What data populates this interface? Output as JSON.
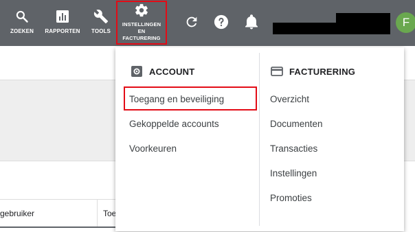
{
  "topbar": {
    "search_label": "ZOEKEN",
    "reports_label": "RAPPORTEN",
    "tools_label": "TOOLS",
    "settings_label_line1": "INSTELLINGEN",
    "settings_label_line2": "EN",
    "settings_label_line3": "FACTURERING",
    "avatar_letter": "F"
  },
  "background": {
    "column_user": "gebruiker",
    "column_next": "Toe"
  },
  "menu": {
    "account": {
      "header": "ACCOUNT",
      "items": [
        "Toegang en beveiliging",
        "Gekoppelde accounts",
        "Voorkeuren"
      ]
    },
    "billing": {
      "header": "FACTURERING",
      "items": [
        "Overzicht",
        "Documenten",
        "Transacties",
        "Instellingen",
        "Promoties"
      ]
    }
  },
  "colors": {
    "topbar": "#5f6368",
    "highlight": "#e30b16",
    "avatar": "#6aa84f"
  }
}
